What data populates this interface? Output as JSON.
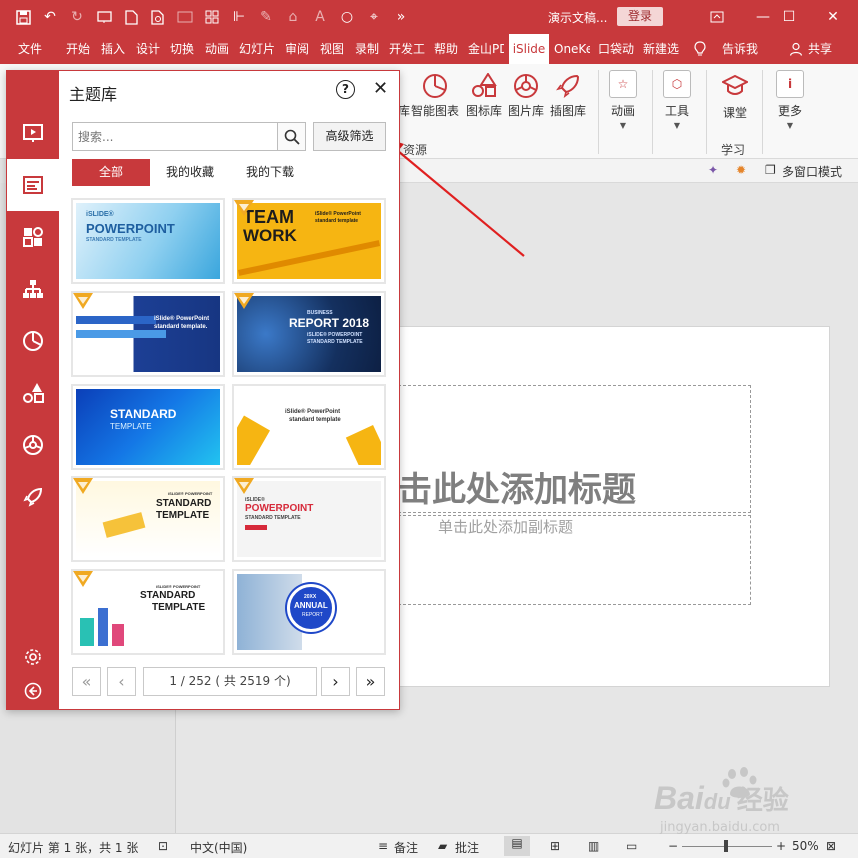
{
  "titlebar": {
    "doc_title": "演示文稿...",
    "login": "登录",
    "qat_icons": [
      "save-icon",
      "undo-icon",
      "redo-icon",
      "slideshow-icon",
      "new-icon",
      "print-preview-icon",
      "picture-icon",
      "grid-icon",
      "align-icon",
      "eyedropper-icon",
      "format-icon",
      "font-color-icon",
      "circle-icon",
      "selection-icon",
      "more-icon"
    ]
  },
  "tabs": [
    "文件",
    "开始",
    "插入",
    "设计",
    "切换",
    "动画",
    "幻灯片",
    "审阅",
    "视图",
    "录制",
    "开发工",
    "帮助",
    "金山PD",
    "iSlide",
    "OneKe",
    "口袋动",
    "新建选"
  ],
  "tell_me": "告诉我",
  "share": "共享",
  "ribbon": {
    "smart_chart": "智能图表",
    "icon_lib": "图标库",
    "picture_lib": "图片库",
    "illustration_lib": "插图库",
    "group_resources": "资源",
    "animation": "动画",
    "tools": "工具",
    "classroom": "课堂",
    "more": "更多",
    "group_learn": "学习",
    "multiwindow": "多窗口模式",
    "cut_off_char": "库"
  },
  "panel": {
    "title": "主题库",
    "search_placeholder": "搜索...",
    "advanced_filter": "高级筛选",
    "filter_tabs": [
      "全部",
      "我的收藏",
      "我的下载"
    ],
    "thumbs": [
      {
        "line1": "iSLIDE®",
        "line2": "POWERPOINT",
        "line3": "STANDARD TEMPLATE"
      },
      {
        "line1": "TEAM",
        "line2": "WORK",
        "line3": "iSlide® PowerPoint standard template"
      },
      {
        "line1": "iSlide® PowerPoint",
        "line2": "standard template."
      },
      {
        "line1": "BUSINESS",
        "line2": "REPORT 2018",
        "line3": "iSLIDE® POWERPOINT STANDARD TEMPLATE"
      },
      {
        "line1": "STANDARD",
        "line2": "TEMPLATE"
      },
      {
        "line1": "iSlide® PowerPoint",
        "line2": "standard template"
      },
      {
        "line1": "iSLIDE® POWERPOINT",
        "line2": "STANDARD",
        "line3": "TEMPLATE"
      },
      {
        "line1": "iSLIDE®",
        "line2": "POWERPOINT",
        "line3": "STANDARD TEMPLATE"
      },
      {
        "line1": "iSLIDE® POWERPOINT",
        "line2": "STANDARD",
        "line3": "TEMPLATE"
      },
      {
        "line1": "20XX",
        "line2": "ANNUAL",
        "line3": "REPORT"
      }
    ],
    "page_info": "1 / 252 ( 共 2519 个)"
  },
  "slide": {
    "title_placeholder": "击此处添加标题",
    "subtitle_placeholder": "单击此处添加副标题"
  },
  "status": {
    "slide_info": "幻灯片 第 1 张，共 1 张",
    "language": "中文(中国)",
    "notes": "备注",
    "comments": "批注",
    "zoom": "50%"
  },
  "watermark": {
    "brand": "Bai",
    "brand2": "du",
    "cn": "经验",
    "url": "jingyan.baidu.com"
  },
  "colors": {
    "accent": "#c8393c"
  }
}
